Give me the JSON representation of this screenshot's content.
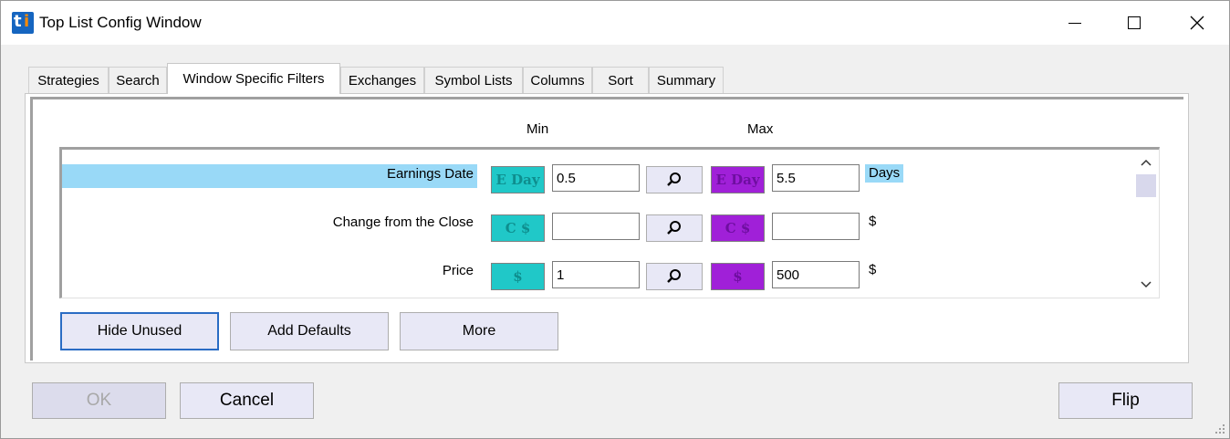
{
  "window": {
    "title": "Top List Config Window"
  },
  "tabs": [
    {
      "label": "Strategies",
      "active": false
    },
    {
      "label": "Search",
      "active": false
    },
    {
      "label": "Window Specific Filters",
      "active": true
    },
    {
      "label": "Exchanges",
      "active": false
    },
    {
      "label": "Symbol Lists",
      "active": false
    },
    {
      "label": "Columns",
      "active": false
    },
    {
      "label": "Sort",
      "active": false
    },
    {
      "label": "Summary",
      "active": false
    }
  ],
  "headers": {
    "min": "Min",
    "max": "Max"
  },
  "filters": [
    {
      "label": "Earnings Date",
      "min_icon_text": "E Day",
      "min_value": "0.5",
      "max_icon_text": "E Day",
      "max_value": "5.5",
      "unit": "Days",
      "selected": true
    },
    {
      "label": "Change from the Close",
      "min_icon_text": "C $",
      "min_value": "",
      "max_icon_text": "C $",
      "max_value": "",
      "unit": "$",
      "selected": false
    },
    {
      "label": "Price",
      "min_icon_text": "$",
      "min_value": "1",
      "max_icon_text": "$",
      "max_value": "500",
      "unit": "$",
      "selected": false
    }
  ],
  "list_buttons": {
    "hide_unused": "Hide Unused",
    "add_defaults": "Add Defaults",
    "more": "More"
  },
  "footer_buttons": {
    "ok": "OK",
    "cancel": "Cancel",
    "flip": "Flip"
  },
  "colors": {
    "min_icon": "#20c8c8",
    "max_icon": "#a020d8",
    "selection": "#99d9f7",
    "focus": "#2a6cc4"
  },
  "icons": {
    "search": "magnifier-icon",
    "app": "ti-logo-icon"
  }
}
